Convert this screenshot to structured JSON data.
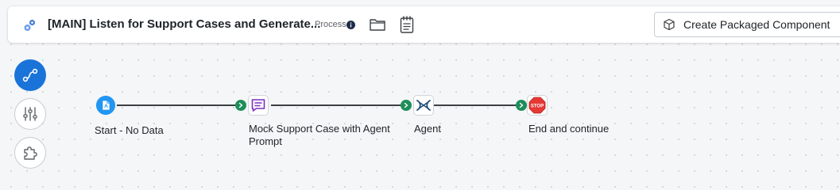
{
  "header": {
    "title": "[MAIN] Listen for Support Cases and Generate...",
    "type_label": "Process",
    "create_button_label": "Create Packaged Component"
  },
  "sidebar": {
    "items": [
      {
        "icon": "route-icon",
        "active": true
      },
      {
        "icon": "sliders-icon",
        "active": false
      },
      {
        "icon": "puzzle-icon",
        "active": false
      }
    ]
  },
  "flow": {
    "nodes": [
      {
        "label": "Start - No Data",
        "icon": "start-document-icon"
      },
      {
        "label": "Mock Support Case with Agent Prompt",
        "icon": "message-icon"
      },
      {
        "label": "Agent",
        "icon": "agent-icon"
      },
      {
        "label": "End and continue",
        "icon": "stop-icon",
        "icon_text": "STOP"
      }
    ]
  },
  "colors": {
    "accent": "#1a73d9",
    "connector": "#1e8e5a",
    "message_node": "#7b2fbe",
    "agent_node": "#1f4e79",
    "stop_node": "#e53935"
  }
}
